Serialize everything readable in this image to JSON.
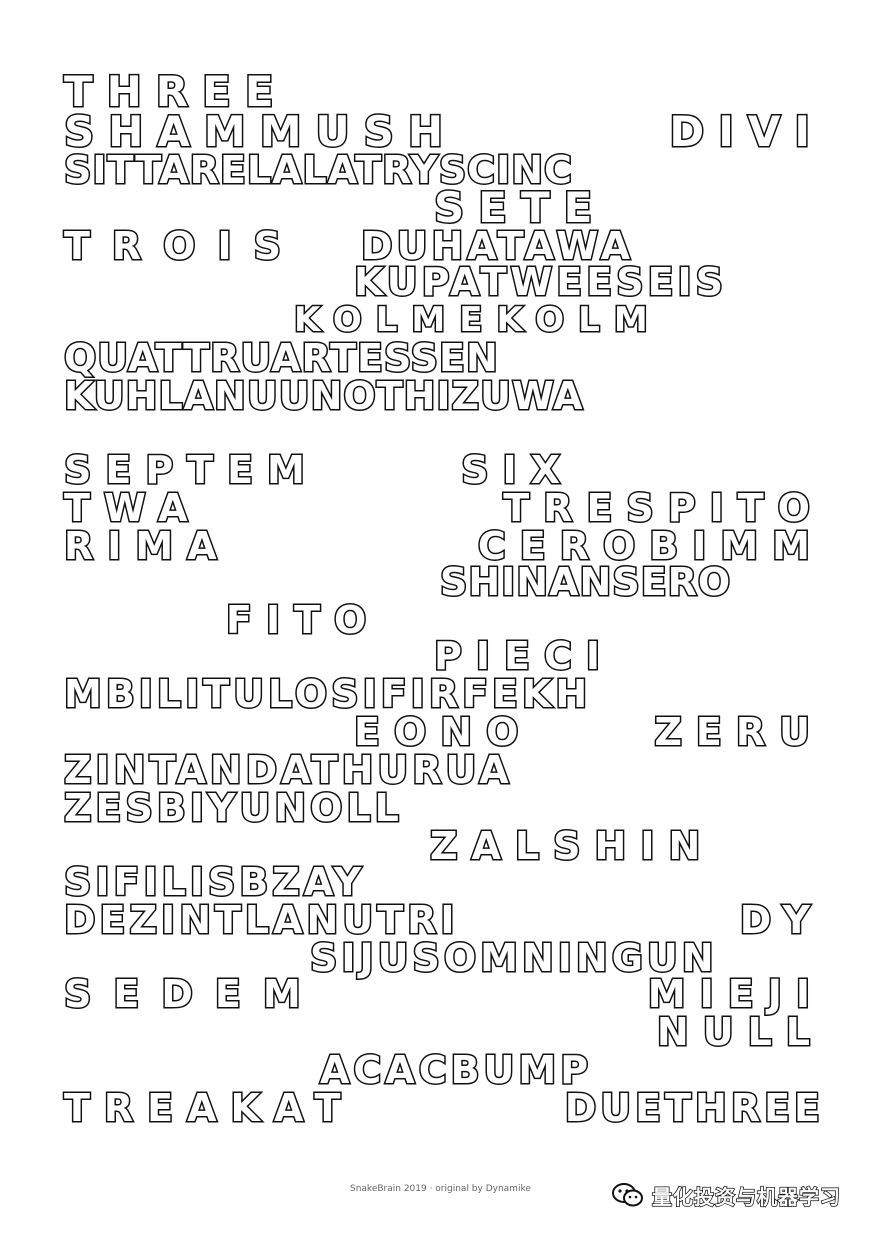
{
  "lines": [
    {
      "left": "THREE",
      "right": ""
    },
    {
      "left": "SHAMMUSH",
      "right": "DIVI"
    },
    {
      "left": "SITTARELALATRYSCINC",
      "right": ""
    },
    {
      "left": "SETE",
      "right": ""
    },
    {
      "left": "TROIS",
      "right": "DUHATAWA"
    },
    {
      "left": "KUPATWEESEIS",
      "right": ""
    },
    {
      "left": "KOLMEKOLM",
      "right": ""
    },
    {
      "left": "QUATTRUARTESSEN",
      "right": ""
    },
    {
      "left": "KUHLANUUNOTHIZUWA",
      "right": ""
    },
    {
      "left": "SEPTEM",
      "right": "SIX"
    },
    {
      "left": "TWA",
      "right": "TRESPITO"
    },
    {
      "left": "RIMA",
      "right": "CEROBIMM"
    },
    {
      "left": "SHINANSERO",
      "right": ""
    },
    {
      "left": "FITO",
      "right": ""
    },
    {
      "left": "PIECI",
      "right": ""
    },
    {
      "left": "MBILITULOSIFIRFEKH",
      "right": ""
    },
    {
      "left": "EONO",
      "right": "ZERU"
    },
    {
      "left": "ZINTANDATHURUA",
      "right": ""
    },
    {
      "left": "ZESBIYUNOLL",
      "right": ""
    },
    {
      "left": "ZALSHIN",
      "right": ""
    },
    {
      "left": "SIFILISBZAY",
      "right": ""
    },
    {
      "left": "DEZINTLANUTRI",
      "right": "DY"
    },
    {
      "left": "SIJUSOMNINGUN",
      "right": ""
    },
    {
      "left": "SEDEM",
      "right": "MIEJI"
    },
    {
      "left": "NULL",
      "right": ""
    },
    {
      "left": "ACACBUMP",
      "right": ""
    },
    {
      "left": "TREAKAT",
      "right": "DUETHREE"
    }
  ],
  "footer": {
    "small_text": "SnakeBrain 2019 · original by Dynamike",
    "brand_text": "量化投资与机器学习",
    "brand_icon": "wechat-icon"
  }
}
